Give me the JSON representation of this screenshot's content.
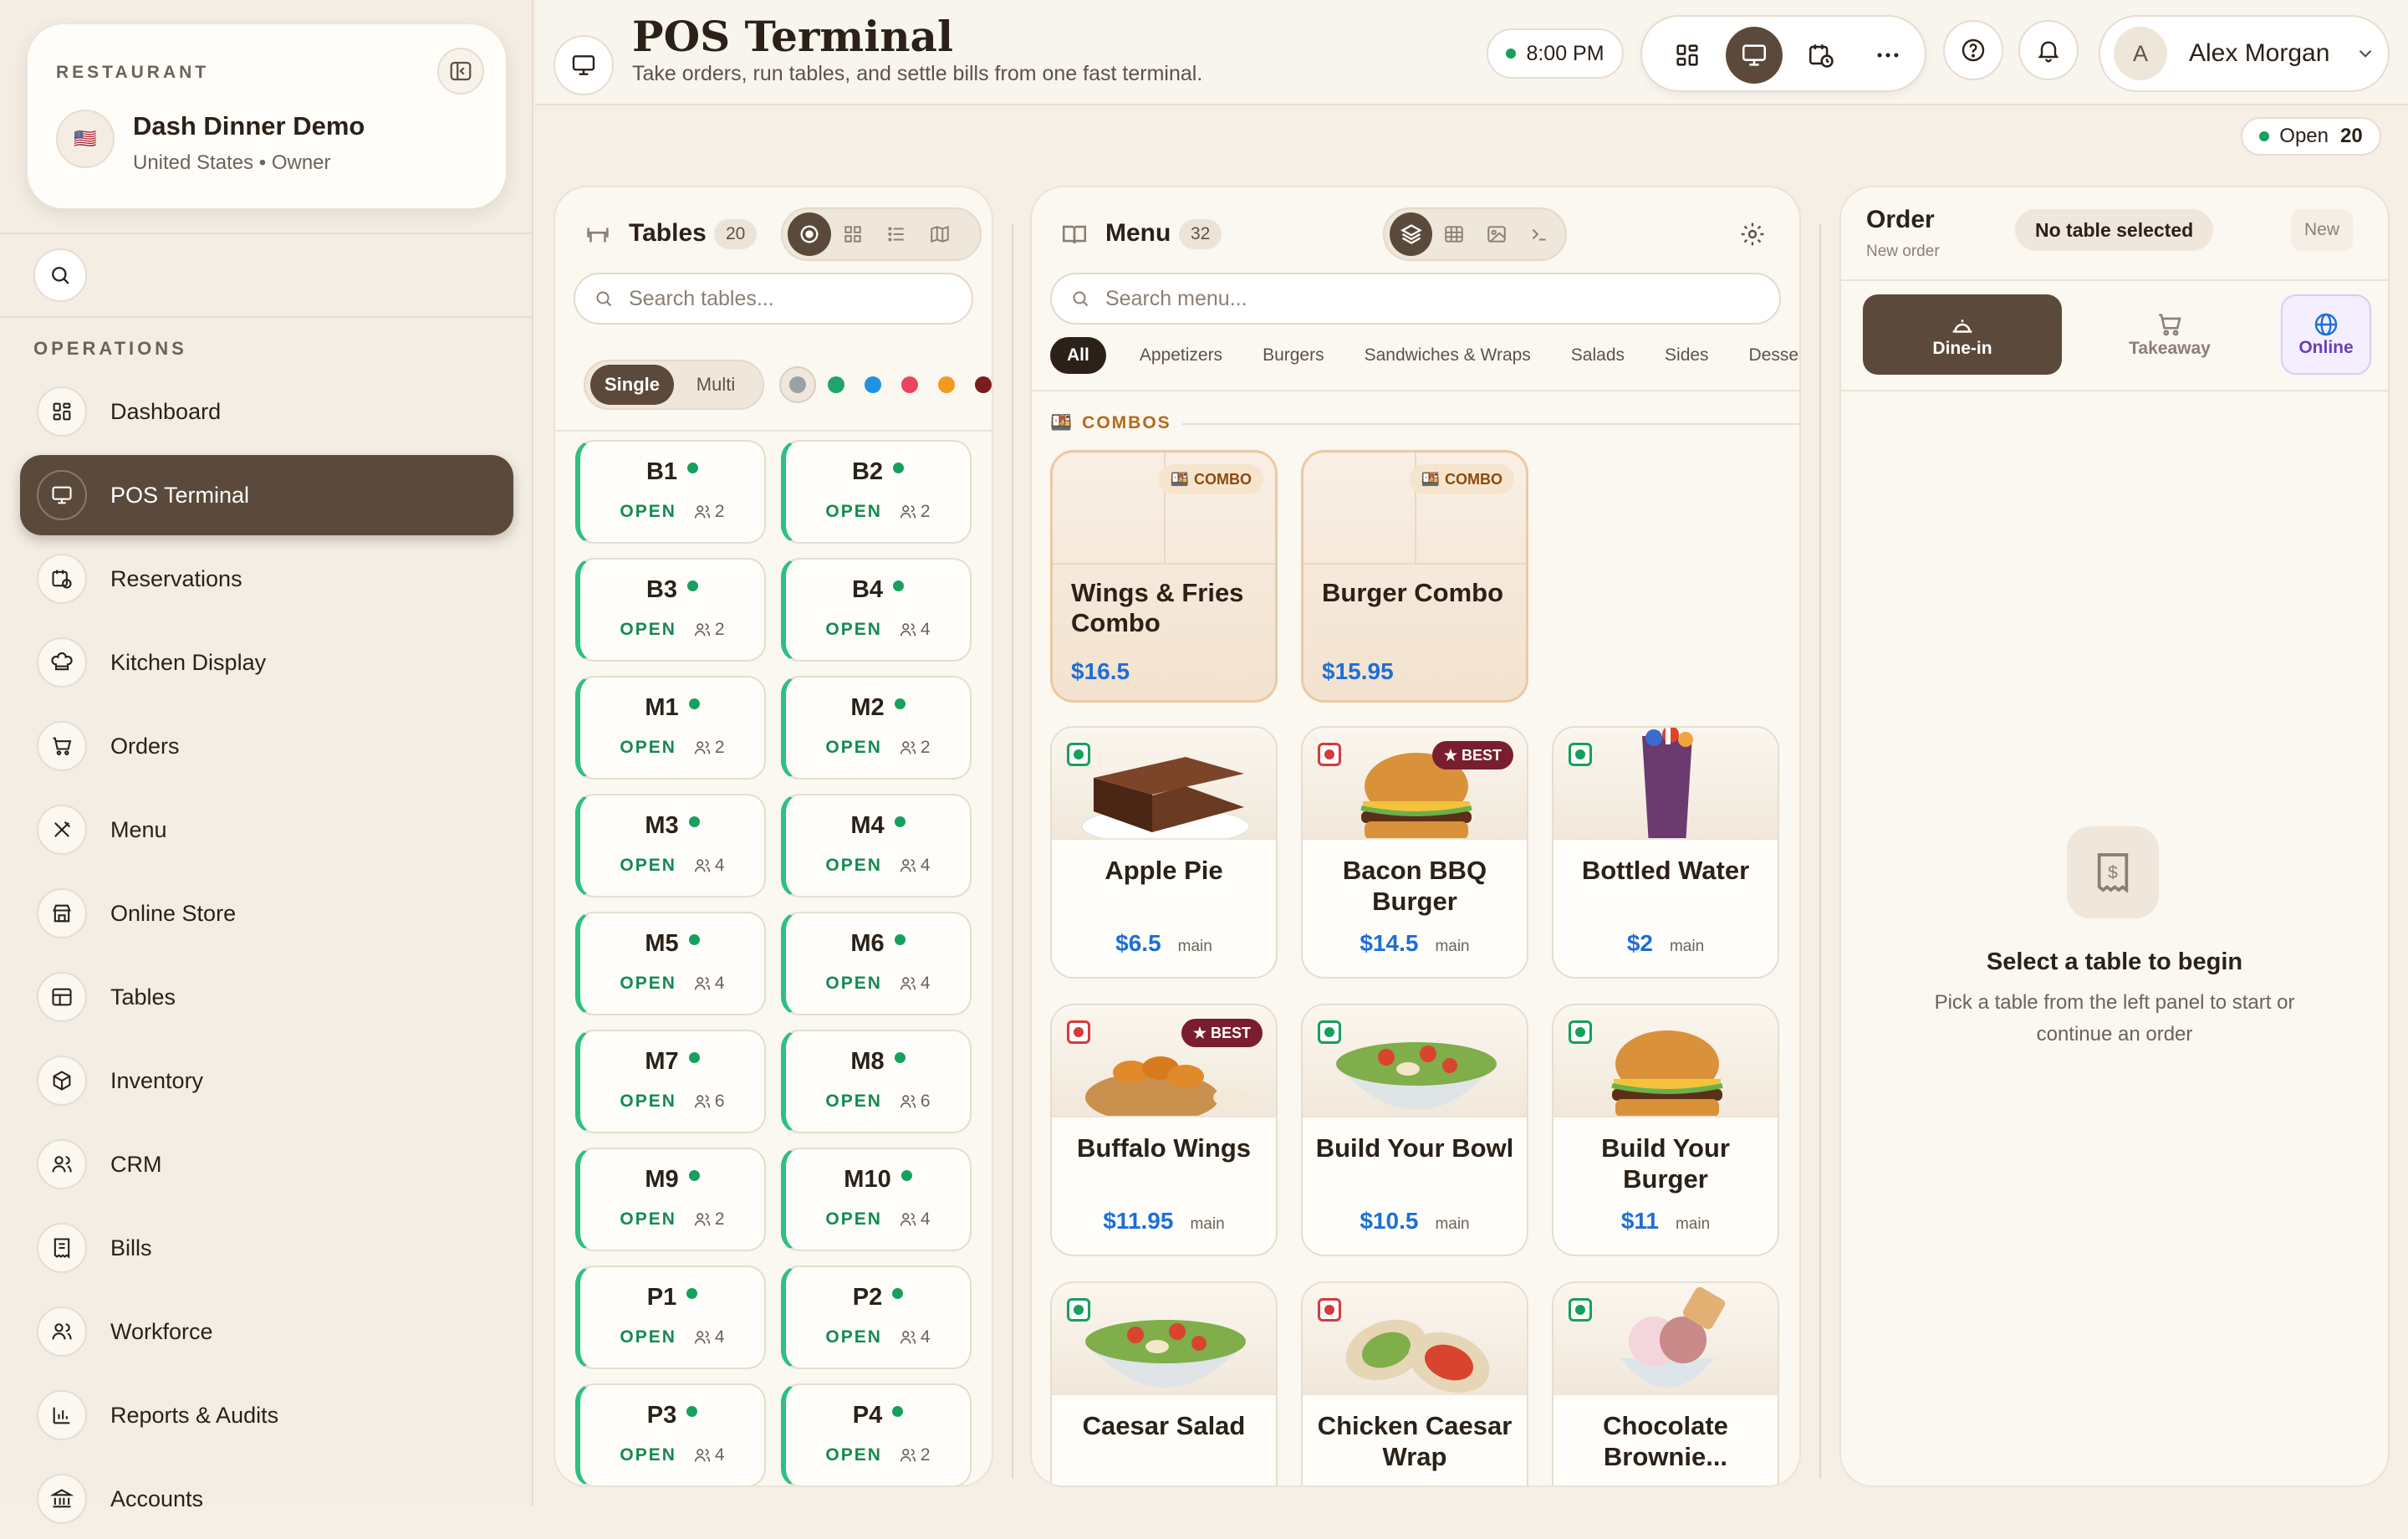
{
  "sidebar": {
    "restaurant_label": "RESTAURANT",
    "flag": "🇺🇸",
    "restaurant_name": "Dash Dinner Demo",
    "restaurant_sub": "United States • Owner",
    "section_label": "OPERATIONS",
    "items": [
      {
        "label": "Dashboard",
        "icon": "dashboard-icon"
      },
      {
        "label": "POS Terminal",
        "icon": "monitor-icon",
        "active": true
      },
      {
        "label": "Reservations",
        "icon": "calendar-clock-icon"
      },
      {
        "label": "Kitchen Display",
        "icon": "chef-hat-icon"
      },
      {
        "label": "Orders",
        "icon": "cart-icon"
      },
      {
        "label": "Menu",
        "icon": "utensils-icon"
      },
      {
        "label": "Online Store",
        "icon": "store-icon"
      },
      {
        "label": "Tables",
        "icon": "table-icon"
      },
      {
        "label": "Inventory",
        "icon": "package-icon"
      },
      {
        "label": "CRM",
        "icon": "users-icon"
      },
      {
        "label": "Bills",
        "icon": "receipt-icon"
      },
      {
        "label": "Workforce",
        "icon": "team-icon"
      },
      {
        "label": "Reports & Audits",
        "icon": "bar-chart-icon"
      },
      {
        "label": "Accounts",
        "icon": "bank-icon"
      }
    ]
  },
  "header": {
    "title": "POS Terminal",
    "subtitle": "Take orders, run tables, and settle bills from one fast terminal.",
    "time": "8:00 PM",
    "user_initial": "A",
    "user_name": "Alex Morgan",
    "open_label": "Open",
    "open_count": "20"
  },
  "tables": {
    "title": "Tables",
    "count": "20",
    "search_placeholder": "Search tables...",
    "mode_single": "Single",
    "mode_multi": "Multi",
    "filter_colors": [
      "#1fa46a",
      "#1e93e0",
      "#e84660",
      "#f29a1b",
      "#7a1d1d"
    ],
    "status_label": "OPEN",
    "items": [
      {
        "name": "B1",
        "cap": "2"
      },
      {
        "name": "B2",
        "cap": "2"
      },
      {
        "name": "B3",
        "cap": "2"
      },
      {
        "name": "B4",
        "cap": "4"
      },
      {
        "name": "M1",
        "cap": "2"
      },
      {
        "name": "M2",
        "cap": "2"
      },
      {
        "name": "M3",
        "cap": "4"
      },
      {
        "name": "M4",
        "cap": "4"
      },
      {
        "name": "M5",
        "cap": "4"
      },
      {
        "name": "M6",
        "cap": "4"
      },
      {
        "name": "M7",
        "cap": "6"
      },
      {
        "name": "M8",
        "cap": "6"
      },
      {
        "name": "M9",
        "cap": "2"
      },
      {
        "name": "M10",
        "cap": "4"
      },
      {
        "name": "P1",
        "cap": "4"
      },
      {
        "name": "P2",
        "cap": "4"
      },
      {
        "name": "P3",
        "cap": "4"
      },
      {
        "name": "P4",
        "cap": "2"
      }
    ]
  },
  "menu": {
    "title": "Menu",
    "count": "32",
    "search_placeholder": "Search menu...",
    "categories": [
      "All",
      "Appetizers",
      "Burgers",
      "Sandwiches & Wraps",
      "Salads",
      "Sides",
      "Desserts"
    ],
    "combos_label": "COMBOS",
    "combo_badge": "COMBO",
    "combos": [
      {
        "name": "Wings & Fries Combo",
        "price": "$16.5"
      },
      {
        "name": "Burger Combo",
        "price": "$15.95"
      }
    ],
    "best_label": "★ BEST",
    "items": [
      {
        "name": "Apple Pie",
        "price": "$6.5",
        "tag": "main",
        "veg": true,
        "best": false,
        "img": "cake"
      },
      {
        "name": "Bacon BBQ Burger",
        "price": "$14.5",
        "tag": "main",
        "veg": false,
        "best": true,
        "img": "burger"
      },
      {
        "name": "Bottled Water",
        "price": "$2",
        "tag": "main",
        "veg": true,
        "best": false,
        "img": "drink"
      },
      {
        "name": "Buffalo Wings",
        "price": "$11.95",
        "tag": "main",
        "veg": false,
        "best": true,
        "img": "wings"
      },
      {
        "name": "Build Your Bowl",
        "price": "$10.5",
        "tag": "main",
        "veg": true,
        "best": false,
        "img": "salad"
      },
      {
        "name": "Build Your Burger",
        "price": "$11",
        "tag": "main",
        "veg": true,
        "best": false,
        "img": "burger"
      },
      {
        "name": "Caesar Salad",
        "price": "",
        "tag": "",
        "veg": true,
        "best": false,
        "img": "salad"
      },
      {
        "name": "Chicken Caesar Wrap",
        "price": "",
        "tag": "",
        "veg": false,
        "best": false,
        "img": "wrap"
      },
      {
        "name": "Chocolate Brownie...",
        "price": "",
        "tag": "",
        "veg": true,
        "best": false,
        "img": "icecream"
      }
    ]
  },
  "order": {
    "title": "Order",
    "subtitle": "New order",
    "no_table": "No table selected",
    "new_label": "New",
    "types": [
      {
        "label": "Dine-in",
        "icon": "dine-in-icon"
      },
      {
        "label": "Takeaway",
        "icon": "cart-icon"
      },
      {
        "label": "Online",
        "icon": "globe-icon"
      }
    ],
    "empty_title": "Select a table to begin",
    "empty_sub": "Pick a table from the left panel to start or continue an order"
  },
  "colors": {
    "accent": "#5b4a3b",
    "open_green": "#16a05d",
    "price_blue": "#1d6fd6",
    "best_red": "#7a1d2e"
  }
}
